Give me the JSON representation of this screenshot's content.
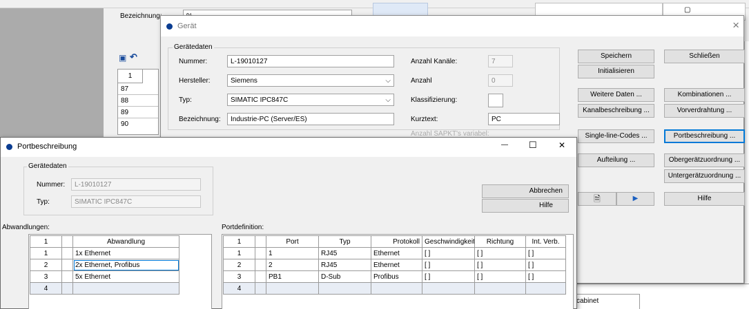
{
  "background": {
    "bezeichnung_label": "Bezeichnung:",
    "bezeichnung_value": "%",
    "row_numbers": [
      "1",
      "87",
      "88",
      "89",
      "90"
    ],
    "bottom_right_cell": "cabinet"
  },
  "geraet": {
    "title": "Gerät",
    "group_title": "Gerätedaten",
    "nummer_label": "Nummer:",
    "nummer_value": "L-19010127",
    "hersteller_label": "Hersteller:",
    "hersteller_value": "Siemens",
    "typ_label": "Typ:",
    "typ_value": "SIMATIC IPC847C",
    "bezeichnung_label": "Bezeichnung:",
    "bezeichnung_value": "Industrie-PC (Server/ES)",
    "anzahl_kanaele_label": "Anzahl Kanäle:",
    "anzahl_kanaele_value": "7",
    "anzahl_label": "Anzahl",
    "anzahl_value": "0",
    "klassifizierung_label": "Klassifizierung:",
    "kurztext_label": "Kurztext:",
    "kurztext_value": "PC",
    "anzahl_sapkt_label": "Anzahl SAPKT's variabel:",
    "buttons": {
      "speichern": "Speichern",
      "schliessen": "Schließen",
      "initialisieren": "Initialisieren",
      "weitere_daten": "Weitere Daten ...",
      "kombinationen": "Kombinationen ...",
      "kanalbeschreibung": "Kanalbeschreibung ...",
      "vorverdrahtung": "Vorverdrahtung ...",
      "single_line": "Single-line-Codes ...",
      "portbeschreibung": "Portbeschreibung ...",
      "aufteilung": "Aufteilung ...",
      "obergeraet": "Obergerätzuordnung ...",
      "untergeraet": "Untergerätzuordnung ...",
      "hilfe": "Hilfe"
    },
    "close_glyph": "×"
  },
  "port": {
    "title": "Portbeschreibung",
    "minimize_glyph": "—",
    "maximize_glyph": "☐",
    "close_glyph": "✕",
    "group_title": "Gerätedaten",
    "nummer_label": "Nummer:",
    "nummer_value": "L-19010127",
    "typ_label": "Typ:",
    "typ_value": "SIMATIC IPC847C",
    "abbrechen": "Abbrechen",
    "hilfe": "Hilfe",
    "abwandlungen_label": "Abwandlungen:",
    "portdefinition_label": "Portdefinition:",
    "abw_header": [
      "1",
      "",
      "Abwandlung"
    ],
    "abw_rows": [
      [
        "1",
        "",
        "1x Ethernet"
      ],
      [
        "2",
        "",
        "2x Ethernet, Profibus"
      ],
      [
        "3",
        "",
        "5x Ethernet"
      ],
      [
        "4",
        "",
        ""
      ]
    ],
    "port_header": [
      "1",
      "",
      "Port",
      "Typ",
      "Protokoll",
      "Geschwindigkeit",
      "Richtung",
      "Int. Verb."
    ],
    "port_rows": [
      [
        "1",
        "",
        "1",
        "RJ45",
        "Ethernet",
        "[ ]",
        "[ ]",
        "[ ]"
      ],
      [
        "2",
        "",
        "2",
        "RJ45",
        "Ethernet",
        "[ ]",
        "[ ]",
        "[ ]"
      ],
      [
        "3",
        "",
        "PB1",
        "D-Sub",
        "Profibus",
        "[ ]",
        "[ ]",
        "[ ]"
      ],
      [
        "4",
        "",
        "",
        "",
        "",
        "",
        "",
        ""
      ]
    ]
  }
}
